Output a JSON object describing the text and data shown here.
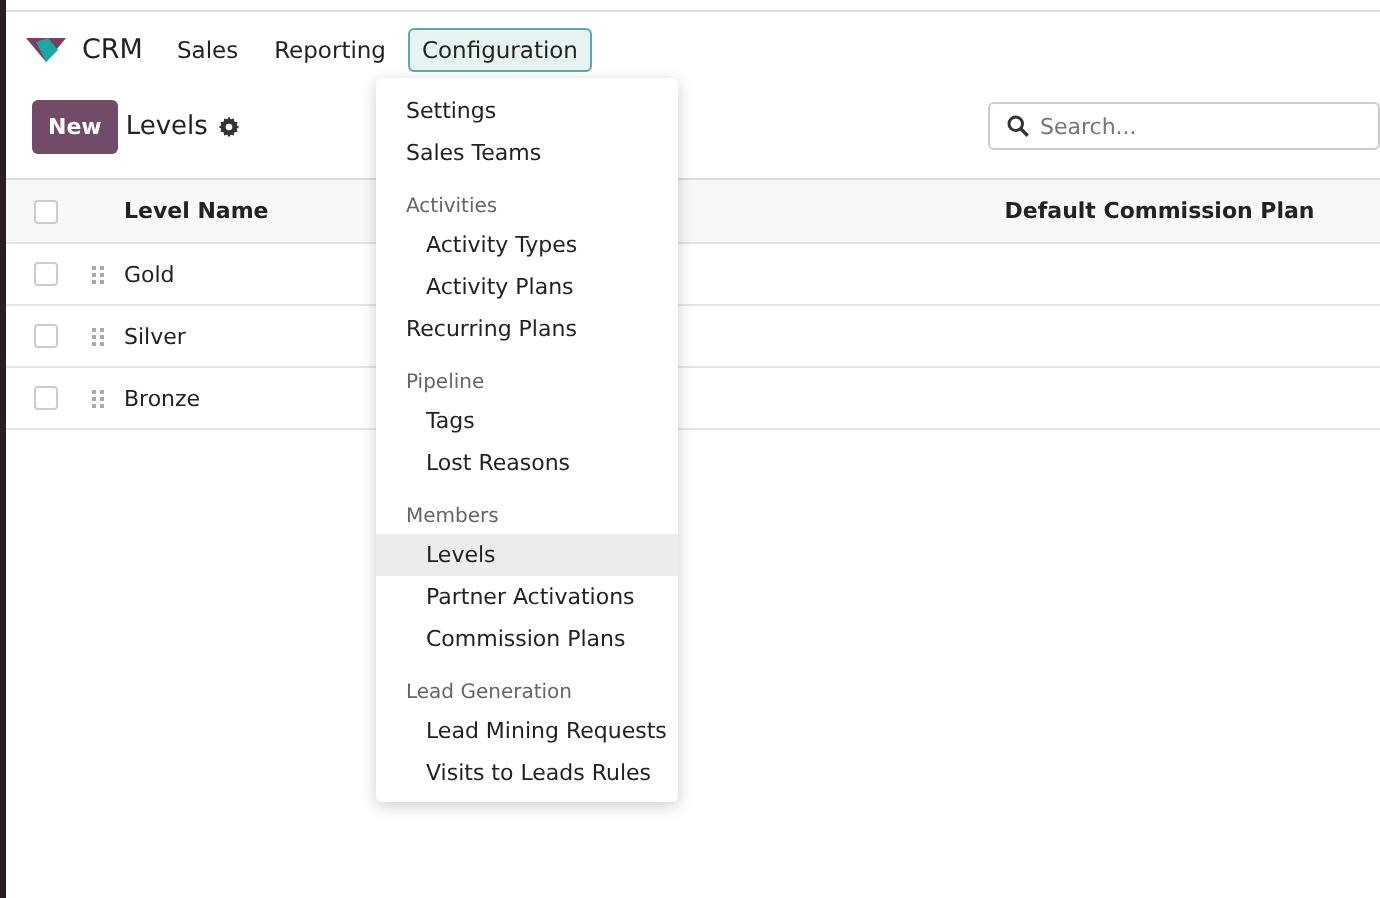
{
  "app": {
    "name": "CRM"
  },
  "menu": [
    {
      "label": "Sales",
      "selected": false
    },
    {
      "label": "Reporting",
      "selected": false
    },
    {
      "label": "Configuration",
      "selected": true
    }
  ],
  "new_button": "New",
  "breadcrumb": "Levels",
  "search": {
    "placeholder": "Search..."
  },
  "table": {
    "select_all": {
      "checked": false
    },
    "columns": [
      "Level Name",
      "Default Commission Plan"
    ],
    "rows": [
      {
        "name": "Gold",
        "checked": false
      },
      {
        "name": "Silver",
        "checked": false
      },
      {
        "name": "Bronze",
        "checked": false
      }
    ]
  },
  "dropdown": [
    {
      "kind": "item",
      "label": "Settings",
      "selected": false
    },
    {
      "kind": "item",
      "label": "Sales Teams",
      "selected": false
    },
    {
      "kind": "header",
      "label": "Activities"
    },
    {
      "kind": "subitem",
      "label": "Activity Types",
      "selected": false
    },
    {
      "kind": "subitem",
      "label": "Activity Plans",
      "selected": false
    },
    {
      "kind": "item",
      "label": "Recurring Plans",
      "selected": false
    },
    {
      "kind": "header",
      "label": "Pipeline"
    },
    {
      "kind": "subitem",
      "label": "Tags",
      "selected": false
    },
    {
      "kind": "subitem",
      "label": "Lost Reasons",
      "selected": false
    },
    {
      "kind": "header",
      "label": "Members"
    },
    {
      "kind": "subitem",
      "label": "Levels",
      "selected": true
    },
    {
      "kind": "subitem",
      "label": "Partner Activations",
      "selected": false
    },
    {
      "kind": "subitem",
      "label": "Commission Plans",
      "selected": false
    },
    {
      "kind": "header",
      "label": "Lead Generation"
    },
    {
      "kind": "subitem",
      "label": "Lead Mining Requests",
      "selected": false
    },
    {
      "kind": "subitem",
      "label": "Visits to Leads Rules",
      "selected": false
    }
  ]
}
